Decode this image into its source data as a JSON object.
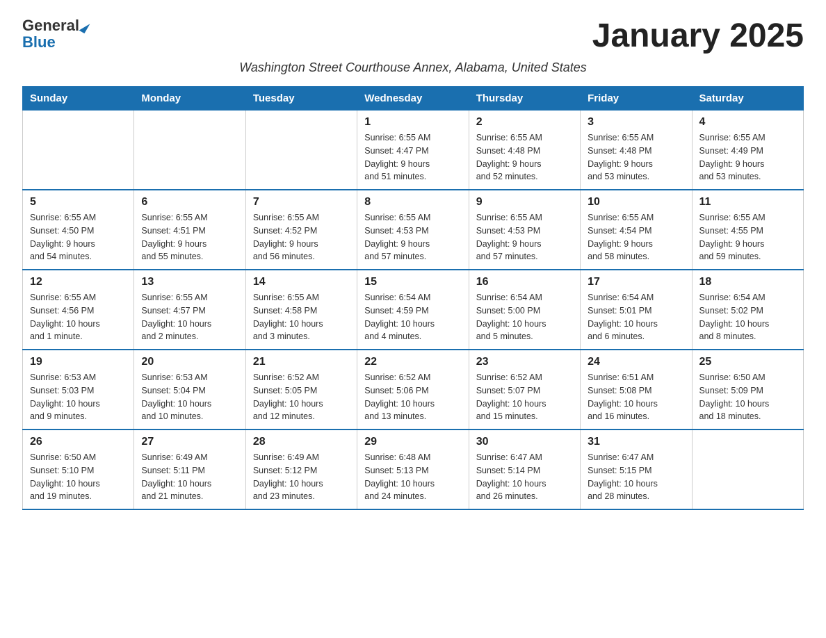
{
  "header": {
    "logo": {
      "general": "General",
      "triangle": "▶",
      "blue": "Blue"
    },
    "title": "January 2025",
    "subtitle": "Washington Street Courthouse Annex, Alabama, United States"
  },
  "calendar": {
    "days_of_week": [
      "Sunday",
      "Monday",
      "Tuesday",
      "Wednesday",
      "Thursday",
      "Friday",
      "Saturday"
    ],
    "weeks": [
      [
        {
          "day": "",
          "info": ""
        },
        {
          "day": "",
          "info": ""
        },
        {
          "day": "",
          "info": ""
        },
        {
          "day": "1",
          "info": "Sunrise: 6:55 AM\nSunset: 4:47 PM\nDaylight: 9 hours\nand 51 minutes."
        },
        {
          "day": "2",
          "info": "Sunrise: 6:55 AM\nSunset: 4:48 PM\nDaylight: 9 hours\nand 52 minutes."
        },
        {
          "day": "3",
          "info": "Sunrise: 6:55 AM\nSunset: 4:48 PM\nDaylight: 9 hours\nand 53 minutes."
        },
        {
          "day": "4",
          "info": "Sunrise: 6:55 AM\nSunset: 4:49 PM\nDaylight: 9 hours\nand 53 minutes."
        }
      ],
      [
        {
          "day": "5",
          "info": "Sunrise: 6:55 AM\nSunset: 4:50 PM\nDaylight: 9 hours\nand 54 minutes."
        },
        {
          "day": "6",
          "info": "Sunrise: 6:55 AM\nSunset: 4:51 PM\nDaylight: 9 hours\nand 55 minutes."
        },
        {
          "day": "7",
          "info": "Sunrise: 6:55 AM\nSunset: 4:52 PM\nDaylight: 9 hours\nand 56 minutes."
        },
        {
          "day": "8",
          "info": "Sunrise: 6:55 AM\nSunset: 4:53 PM\nDaylight: 9 hours\nand 57 minutes."
        },
        {
          "day": "9",
          "info": "Sunrise: 6:55 AM\nSunset: 4:53 PM\nDaylight: 9 hours\nand 57 minutes."
        },
        {
          "day": "10",
          "info": "Sunrise: 6:55 AM\nSunset: 4:54 PM\nDaylight: 9 hours\nand 58 minutes."
        },
        {
          "day": "11",
          "info": "Sunrise: 6:55 AM\nSunset: 4:55 PM\nDaylight: 9 hours\nand 59 minutes."
        }
      ],
      [
        {
          "day": "12",
          "info": "Sunrise: 6:55 AM\nSunset: 4:56 PM\nDaylight: 10 hours\nand 1 minute."
        },
        {
          "day": "13",
          "info": "Sunrise: 6:55 AM\nSunset: 4:57 PM\nDaylight: 10 hours\nand 2 minutes."
        },
        {
          "day": "14",
          "info": "Sunrise: 6:55 AM\nSunset: 4:58 PM\nDaylight: 10 hours\nand 3 minutes."
        },
        {
          "day": "15",
          "info": "Sunrise: 6:54 AM\nSunset: 4:59 PM\nDaylight: 10 hours\nand 4 minutes."
        },
        {
          "day": "16",
          "info": "Sunrise: 6:54 AM\nSunset: 5:00 PM\nDaylight: 10 hours\nand 5 minutes."
        },
        {
          "day": "17",
          "info": "Sunrise: 6:54 AM\nSunset: 5:01 PM\nDaylight: 10 hours\nand 6 minutes."
        },
        {
          "day": "18",
          "info": "Sunrise: 6:54 AM\nSunset: 5:02 PM\nDaylight: 10 hours\nand 8 minutes."
        }
      ],
      [
        {
          "day": "19",
          "info": "Sunrise: 6:53 AM\nSunset: 5:03 PM\nDaylight: 10 hours\nand 9 minutes."
        },
        {
          "day": "20",
          "info": "Sunrise: 6:53 AM\nSunset: 5:04 PM\nDaylight: 10 hours\nand 10 minutes."
        },
        {
          "day": "21",
          "info": "Sunrise: 6:52 AM\nSunset: 5:05 PM\nDaylight: 10 hours\nand 12 minutes."
        },
        {
          "day": "22",
          "info": "Sunrise: 6:52 AM\nSunset: 5:06 PM\nDaylight: 10 hours\nand 13 minutes."
        },
        {
          "day": "23",
          "info": "Sunrise: 6:52 AM\nSunset: 5:07 PM\nDaylight: 10 hours\nand 15 minutes."
        },
        {
          "day": "24",
          "info": "Sunrise: 6:51 AM\nSunset: 5:08 PM\nDaylight: 10 hours\nand 16 minutes."
        },
        {
          "day": "25",
          "info": "Sunrise: 6:50 AM\nSunset: 5:09 PM\nDaylight: 10 hours\nand 18 minutes."
        }
      ],
      [
        {
          "day": "26",
          "info": "Sunrise: 6:50 AM\nSunset: 5:10 PM\nDaylight: 10 hours\nand 19 minutes."
        },
        {
          "day": "27",
          "info": "Sunrise: 6:49 AM\nSunset: 5:11 PM\nDaylight: 10 hours\nand 21 minutes."
        },
        {
          "day": "28",
          "info": "Sunrise: 6:49 AM\nSunset: 5:12 PM\nDaylight: 10 hours\nand 23 minutes."
        },
        {
          "day": "29",
          "info": "Sunrise: 6:48 AM\nSunset: 5:13 PM\nDaylight: 10 hours\nand 24 minutes."
        },
        {
          "day": "30",
          "info": "Sunrise: 6:47 AM\nSunset: 5:14 PM\nDaylight: 10 hours\nand 26 minutes."
        },
        {
          "day": "31",
          "info": "Sunrise: 6:47 AM\nSunset: 5:15 PM\nDaylight: 10 hours\nand 28 minutes."
        },
        {
          "day": "",
          "info": ""
        }
      ]
    ]
  }
}
